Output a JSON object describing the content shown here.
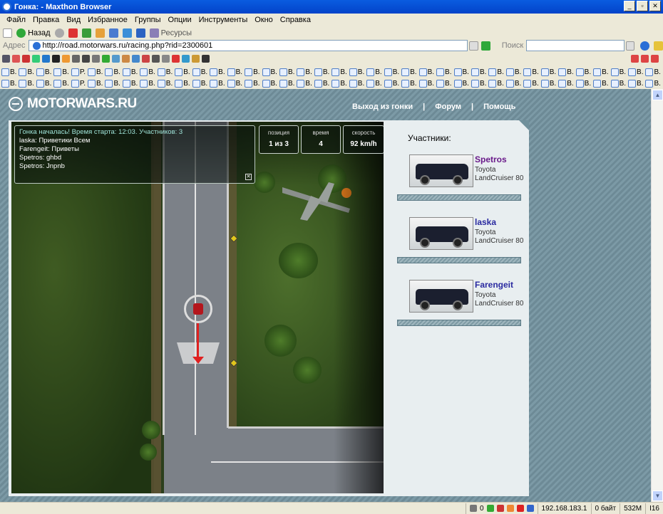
{
  "window": {
    "title": "Гонка: - Maxthon Browser"
  },
  "menu": [
    "Файл",
    "Правка",
    "Вид",
    "Избранное",
    "Группы",
    "Опции",
    "Инструменты",
    "Окно",
    "Справка"
  ],
  "toolbar": {
    "back_label": "Назад",
    "resources_label": "Ресурсы"
  },
  "address": {
    "label": "Адрес",
    "url": "http://road.motorwars.ru/racing.php?rid=2300601",
    "search_label": "Поиск"
  },
  "site": {
    "logo": "MOTORWARS.RU",
    "nav": [
      "Выход из гонки",
      "Форум",
      "Помощь"
    ],
    "nav_sep": "|"
  },
  "chat": {
    "lines": [
      "Гонка началась! Время старта: 12:03. Участников: 3",
      "laska: Приветики Всем",
      "Farengeit: Приветы",
      "Spetros: ghbd",
      "Spetros: Jnpnb"
    ],
    "close_glyph": "✕"
  },
  "hud": {
    "position": {
      "caption": "позиция",
      "value": "1 из 3"
    },
    "time": {
      "caption": "время",
      "value": "4"
    },
    "speed": {
      "caption": "скорость",
      "value": "92 km/h"
    }
  },
  "participants": {
    "title": "Участники:",
    "list": [
      {
        "name": "Spetros",
        "model": "Toyota LandCruiser 80",
        "visited": true
      },
      {
        "name": "laska",
        "model": "Toyota LandCruiser 80",
        "visited": false
      },
      {
        "name": "Farengeit",
        "model": "Toyota LandCruiser 80",
        "visited": false
      }
    ]
  },
  "status": {
    "counter": "0",
    "ip": "192.168.183.1",
    "bytes": "0 байт",
    "memory": "532M",
    "extra": "I16"
  },
  "favorites": [
    "B.",
    "B.",
    "B.",
    "B.",
    "P.",
    "B.",
    "B.",
    "B.",
    "B.",
    "B.",
    "B.",
    "B.",
    "B.",
    "B.",
    "B.",
    "B.",
    "B.",
    "B.",
    "B.",
    "B.",
    "B.",
    "B.",
    "B.",
    "B.",
    "B.",
    "B.",
    "B.",
    "B.",
    "B.",
    "B.",
    "B.",
    "B.",
    "B.",
    "B.",
    "B.",
    "B.",
    "B.",
    "B.",
    "B.",
    "B.",
    "B.",
    "B."
  ]
}
